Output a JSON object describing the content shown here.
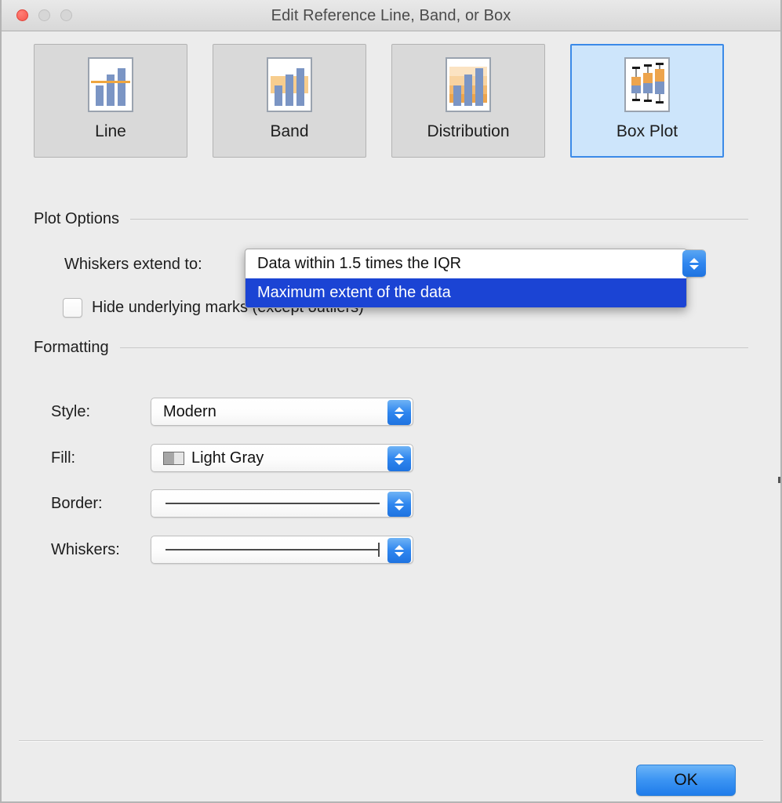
{
  "window": {
    "title": "Edit Reference Line, Band, or Box",
    "controls": {
      "close": "close-button",
      "minimize": "minimize-button",
      "maximize": "maximize-button"
    }
  },
  "tabs": [
    {
      "label": "Line",
      "icon": "line-chart-icon",
      "selected": false
    },
    {
      "label": "Band",
      "icon": "band-chart-icon",
      "selected": false
    },
    {
      "label": "Distribution",
      "icon": "distribution-chart-icon",
      "selected": false
    },
    {
      "label": "Box Plot",
      "icon": "box-plot-chart-icon",
      "selected": true
    }
  ],
  "plot_options": {
    "section_title": "Plot Options",
    "whiskers_label": "Whiskers extend to:",
    "whiskers_value": "Maximum extent of the data",
    "hide_marks_label": "Hide underlying marks (except outliers)",
    "hide_marks_checked": false,
    "dropdown_open": true,
    "dropdown_items": [
      {
        "label": "Data within 1.5 times the IQR",
        "highlighted": false
      },
      {
        "label": "Maximum extent of the data",
        "highlighted": true
      }
    ]
  },
  "formatting": {
    "section_title": "Formatting",
    "style_label": "Style:",
    "style_value": "Modern",
    "fill_label": "Fill:",
    "fill_value": "Light Gray",
    "fill_swatch": "gray-gradient-swatch-icon",
    "border_label": "Border:",
    "border_value": "solid-line-preview",
    "whiskers_label": "Whiskers:",
    "whiskers_value": "line-with-end-cap-preview"
  },
  "footer": {
    "ok_label": "OK"
  },
  "colors": {
    "window_bg": "#ececec",
    "selected_tab_bg": "#cde5fb",
    "selected_tab_border": "#3b8ae8",
    "menu_highlight": "#1b44d4",
    "stepper_blue": "#2f86ef",
    "ok_button_blue": "#3c95f3",
    "icon_bar_blue": "#7b95c4",
    "icon_accent_orange": "#eda44c",
    "close_red": "#f6564c"
  }
}
